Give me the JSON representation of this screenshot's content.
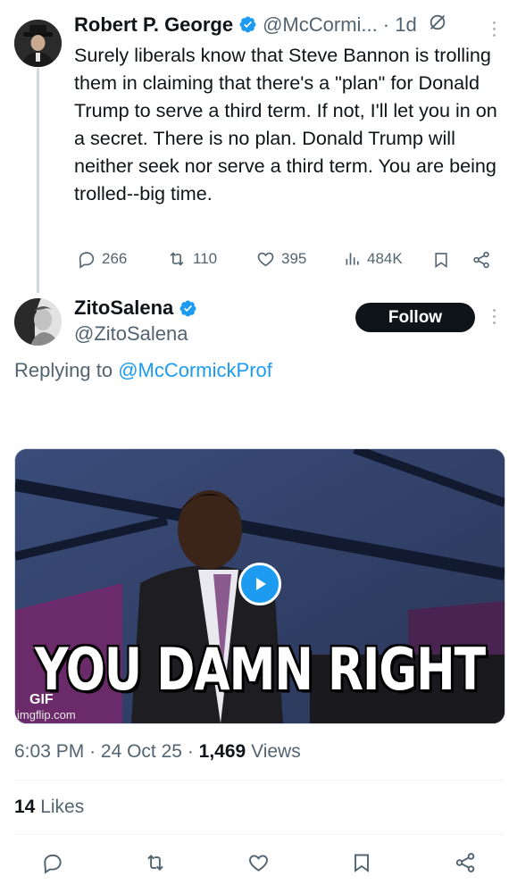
{
  "parent_tweet": {
    "author_name": "Robert P. George",
    "handle": "@McCormi...",
    "time": "· 1d",
    "text": "Surely liberals know that Steve Bannon is trolling them in claiming that there's a \"plan\" for Donald Trump to serve a third term. If not, I'll let you in on a secret. There is no plan. Donald Trump will neither seek nor serve a third term. You are being trolled--big time.",
    "actions": {
      "replies": "266",
      "reposts": "110",
      "likes": "395",
      "views": "484K"
    }
  },
  "reply_tweet": {
    "author_name": "ZitoSalena",
    "handle": "@ZitoSalena",
    "follow_label": "Follow",
    "replying_prefix": "Replying to",
    "replying_to": "@McCormickProf",
    "gif": {
      "caption": "YOU DAMN RIGHT",
      "badge": "GIF",
      "watermark": "imgflip.com"
    },
    "meta": {
      "time": "6:03 PM",
      "date": "24 Oct 25",
      "views_count": "1,469",
      "views_label": "Views"
    },
    "likes_count": "14",
    "likes_label": "Likes"
  },
  "colors": {
    "accent": "#1d9bf0",
    "text": "#0f1419",
    "muted": "#536471",
    "follow_bg": "#0f1419"
  }
}
